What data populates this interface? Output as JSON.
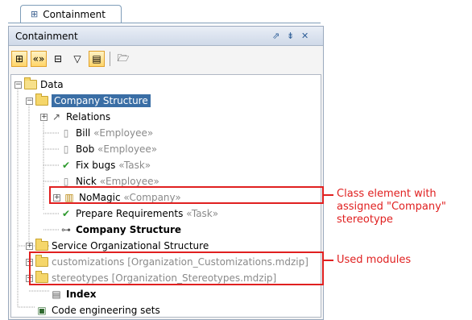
{
  "tab": {
    "label": "Containment"
  },
  "panel": {
    "title": "Containment",
    "controls": [
      "⇗",
      "⇟",
      "✕"
    ]
  },
  "tree": {
    "root": "Data",
    "company_structure": "Company Structure",
    "relations": "Relations",
    "bill": {
      "name": "Bill",
      "stereo": "«Employee»"
    },
    "bob": {
      "name": "Bob",
      "stereo": "«Employee»"
    },
    "fix_bugs": {
      "name": "Fix bugs",
      "stereo": "«Task»"
    },
    "nick": {
      "name": "Nick",
      "stereo": "«Employee»"
    },
    "nomagic": {
      "name": "NoMagic",
      "stereo": "«Company»"
    },
    "prepare": {
      "name": "Prepare Requirements",
      "stereo": "«Task»"
    },
    "company_diagram": "Company Structure",
    "service": "Service Organizational Structure",
    "customizations": "customizations [Organization_Customizations.mdzip]",
    "stereotypes": "stereotypes [Organization_Stereotypes.mdzip]",
    "index": "Index",
    "code_sets": "Code engineering sets"
  },
  "annotations": {
    "class_element": "Class element with assigned \"Company\" stereotype",
    "used_modules": "Used modules"
  },
  "colors": {
    "highlight": "#e02020",
    "selection": "#3a6ea5"
  }
}
